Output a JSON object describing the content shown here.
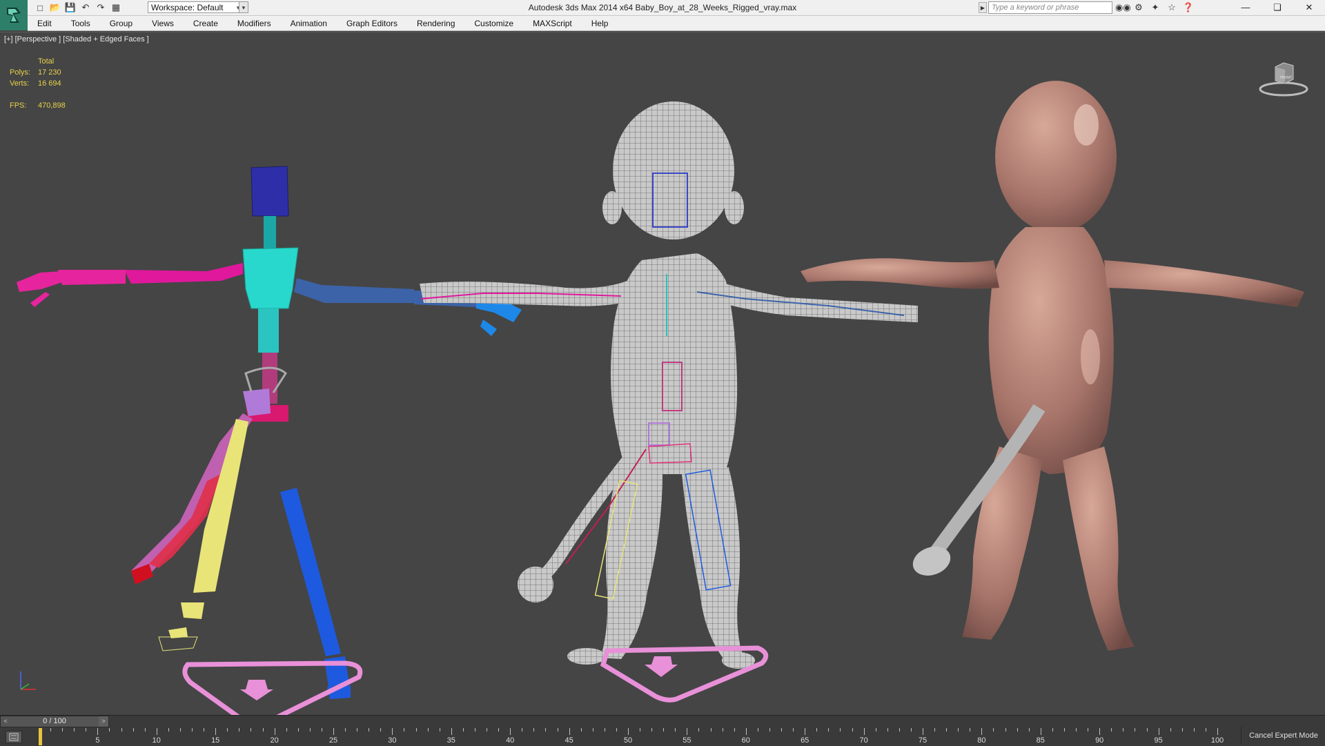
{
  "window": {
    "title": "Autodesk 3ds Max  2014 x64      Baby_Boy_at_28_Weeks_Rigged_vray.max",
    "workspace": "Workspace: Default",
    "search_placeholder": "Type a keyword or phrase"
  },
  "menu": [
    "Edit",
    "Tools",
    "Group",
    "Views",
    "Create",
    "Modifiers",
    "Animation",
    "Graph Editors",
    "Rendering",
    "Customize",
    "MAXScript",
    "Help"
  ],
  "viewport": {
    "label": "[+] [Perspective ] [Shaded + Edged Faces ]",
    "stats": {
      "header": "Total",
      "polys_label": "Polys:",
      "polys": "17 230",
      "verts_label": "Verts:",
      "verts": "16 694",
      "fps_label": "FPS:",
      "fps": "470,898"
    },
    "viewcube_label": "FRONT"
  },
  "timeline": {
    "frame_display": "0 / 100",
    "current_frame": 0,
    "ticks": [
      0,
      5,
      10,
      15,
      20,
      25,
      30,
      35,
      40,
      45,
      50,
      55,
      60,
      65,
      70,
      75,
      80,
      85,
      90,
      95,
      100
    ],
    "cancel_expert": "Cancel Expert Mode"
  },
  "colors": {
    "viewport_bg": "#454545",
    "stats_text": "#e8d24a",
    "titlebar": "#f0f0f0",
    "timeline_bg": "#3a3a3a"
  }
}
